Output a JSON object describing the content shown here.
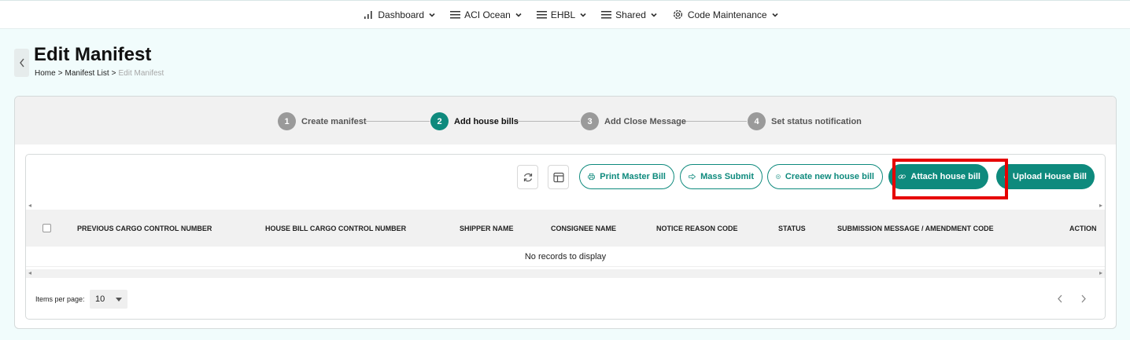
{
  "nav": {
    "items": [
      {
        "label": "Dashboard",
        "icon": "bar-chart-icon"
      },
      {
        "label": "ACI Ocean",
        "icon": "menu-icon"
      },
      {
        "label": "EHBL",
        "icon": "menu-icon"
      },
      {
        "label": "Shared",
        "icon": "menu-icon"
      },
      {
        "label": "Code Maintenance",
        "icon": "gear-icon"
      }
    ]
  },
  "header": {
    "title": "Edit Manifest",
    "breadcrumb": [
      "Home",
      "Manifest List",
      "Edit Manifest"
    ],
    "separator": ">"
  },
  "steps": [
    {
      "num": "1",
      "label": "Create manifest"
    },
    {
      "num": "2",
      "label": "Add house bills"
    },
    {
      "num": "3",
      "label": "Add Close Message"
    },
    {
      "num": "4",
      "label": "Set status notification"
    }
  ],
  "active_step": 2,
  "toolbar": {
    "print_master_bill": "Print Master Bill",
    "mass_submit": "Mass Submit",
    "create_new_house_bill": "Create new house bill",
    "attach_house_bill": "Attach house bill",
    "upload_house_bill": "Upload House Bill"
  },
  "table": {
    "columns": [
      "PREVIOUS CARGO CONTROL NUMBER",
      "HOUSE BILL CARGO CONTROL NUMBER",
      "SHIPPER NAME",
      "CONSIGNEE NAME",
      "NOTICE REASON CODE",
      "STATUS",
      "SUBMISSION MESSAGE / AMENDMENT CODE",
      "ACTION"
    ],
    "empty_message": "No records to display"
  },
  "pagination": {
    "items_per_page_label": "Items per page:",
    "items_per_page": "10"
  },
  "colors": {
    "accent": "#0e8a7d",
    "highlight": "#e60000"
  }
}
